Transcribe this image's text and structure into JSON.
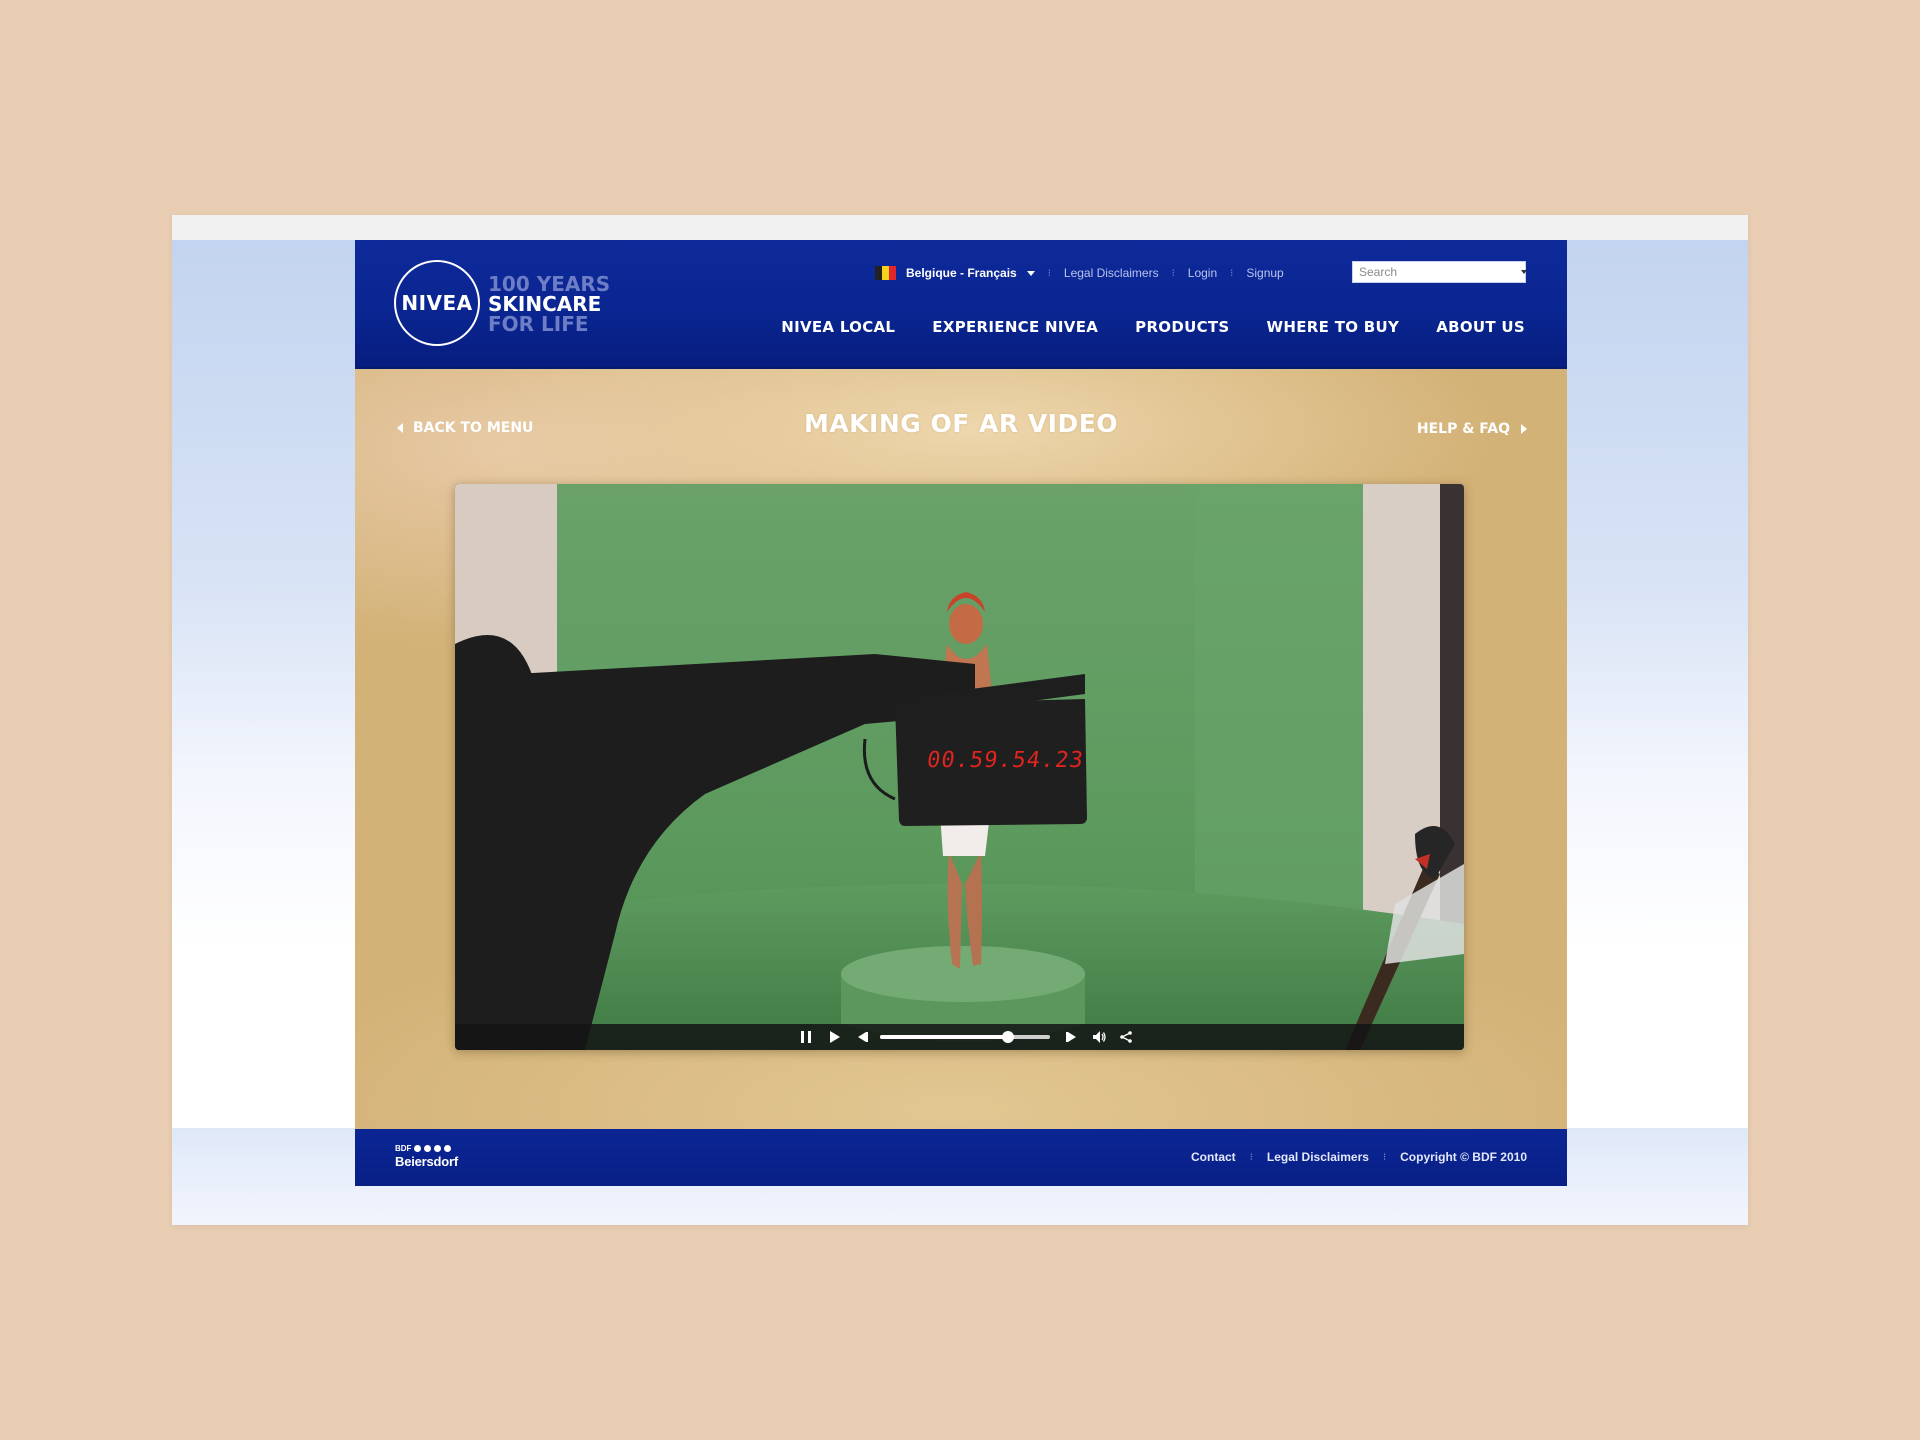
{
  "brand": {
    "logo_text": "NIVEA",
    "tagline": [
      "100 YEARS",
      "SKINCARE",
      "FOR LIFE"
    ]
  },
  "utility": {
    "country": "Belgique - Français",
    "links": [
      "Legal Disclaimers",
      "Login",
      "Signup"
    ],
    "search_placeholder": "Search"
  },
  "nav": {
    "items": [
      "NIVEA LOCAL",
      "EXPERIENCE NIVEA",
      "PRODUCTS",
      "WHERE TO BUY",
      "ABOUT US"
    ]
  },
  "stage": {
    "title": "MAKING OF AR VIDEO",
    "back_label": "BACK TO MENU",
    "help_label": "HELP & FAQ"
  },
  "video": {
    "clapper_time": "00.59.54.23",
    "progress": 0.75,
    "controls": [
      "pause-icon",
      "play-icon",
      "rewind-icon",
      "forward-icon",
      "volume-icon",
      "share-icon"
    ]
  },
  "footer": {
    "brand_small": "BDF",
    "brand_name": "Beiersdorf",
    "links": [
      "Contact",
      "Legal Disclaimers",
      "Copyright © BDF 2010"
    ]
  },
  "colors": {
    "header_blue": "#0a2590",
    "stage_gold": "#d3b277",
    "page_background": "#e8cdb3",
    "chroma_green": "#5f9c5e",
    "clapper_red": "#e0241f"
  }
}
